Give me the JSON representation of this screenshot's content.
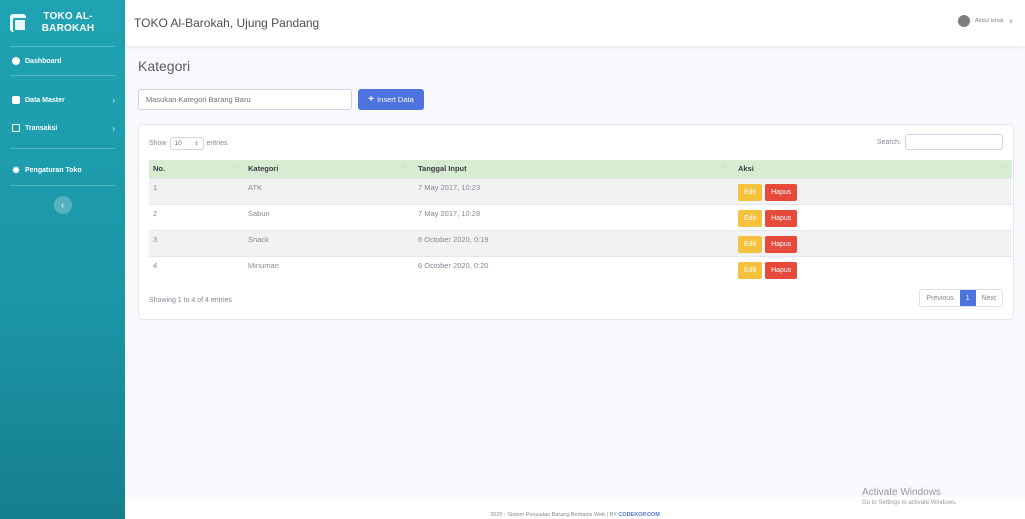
{
  "sidebar": {
    "brand": "TOKO AL-BAROKAH",
    "items": [
      {
        "label": "Dashboard",
        "icon": "dashboard-icon"
      },
      {
        "label": "Data Master",
        "icon": "database-icon"
      },
      {
        "label": "Transaksi",
        "icon": "desktop-icon"
      },
      {
        "label": "Pengaturan Toko",
        "icon": "cogs-icon"
      }
    ],
    "toggle": "‹"
  },
  "topbar": {
    "title": "TOKO Al-Barokah, Ujung Pandang",
    "user": "Abdul Ishak"
  },
  "main": {
    "page_title": "Kategori",
    "input_placeholder": "Masukan Kategori Barang Baru",
    "insert_label": "Insert Data",
    "table": {
      "show": "Show",
      "length": "10",
      "entries": "entries",
      "search": "Search:",
      "headers": [
        "No.",
        "Kategori",
        "Tanggal Input",
        "Aksi"
      ],
      "rows": [
        {
          "no": "1",
          "kategori": "ATK",
          "tanggal": "7 May 2017, 10:23"
        },
        {
          "no": "2",
          "kategori": "Sabun",
          "tanggal": "7 May 2017, 10:28"
        },
        {
          "no": "3",
          "kategori": "Snack",
          "tanggal": "6 October 2020, 0:19"
        },
        {
          "no": "4",
          "kategori": "Minuman",
          "tanggal": "6 October 2020, 0:20"
        }
      ],
      "edit_label": "Edit",
      "hapus_label": "Hapus",
      "info": "Showing 1 to 4 of 4 entries",
      "pagination": {
        "previous": "Previous",
        "current": "1",
        "next": "Next"
      }
    }
  },
  "footer": {
    "text": "2025 - Sistem Penjualan Barang Berbasis Web | BY",
    "link": "CODEKOP.COM"
  },
  "watermark": {
    "line1": "Activate Windows",
    "line2": "Go to Settings to activate Windows."
  },
  "colors": {
    "sidebar": "#1fa3b2",
    "primary": "#4e73df",
    "warning": "#f6c23e",
    "danger": "#e74a3b",
    "table_header": "#d8ecd2"
  }
}
